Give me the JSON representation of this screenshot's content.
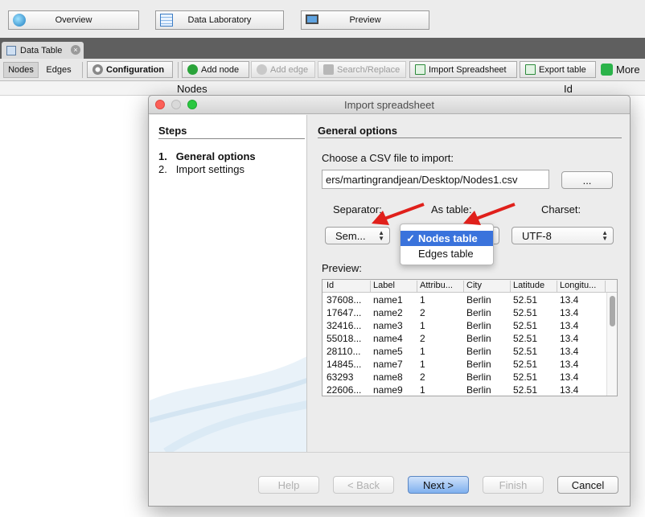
{
  "workspace": {
    "overview": "Overview",
    "data_laboratory": "Data Laboratory",
    "preview": "Preview"
  },
  "tabstrip": {
    "tab_label": "Data Table",
    "close_glyph": "×"
  },
  "toolbar": {
    "nodes_tab": "Nodes",
    "edges_tab": "Edges",
    "configuration": "Configuration",
    "add_node": "Add node",
    "add_edge": "Add edge",
    "search_replace": "Search/Replace",
    "import_spreadsheet": "Import Spreadsheet",
    "export_table": "Export table",
    "more": "More"
  },
  "table": {
    "col_nodes": "Nodes",
    "col_id": "Id"
  },
  "dialog": {
    "title": "Import spreadsheet",
    "steps_title": "Steps",
    "steps": [
      {
        "num": "1.",
        "label": "General options"
      },
      {
        "num": "2.",
        "label": "Import settings"
      }
    ],
    "section_title": "General options",
    "choose_label": "Choose a CSV file to import:",
    "file_path": "ers/martingrandjean/Desktop/Nodes1.csv",
    "browse_label": "...",
    "separator_label": "Separator:",
    "as_table_label": "As table:",
    "charset_label": "Charset:",
    "separator_value": "Sem...",
    "charset_value": "UTF-8",
    "as_table_options": [
      {
        "label": "Nodes table",
        "checkmark": "✓",
        "selected": true
      },
      {
        "label": "Edges table",
        "checkmark": "",
        "selected": false
      }
    ],
    "preview_label": "Preview:",
    "preview": {
      "columns": [
        "Id",
        "Label",
        "Attribu...",
        "City",
        "Latitude",
        "Longitu..."
      ],
      "rows": [
        [
          "37608...",
          "name1",
          "1",
          "Berlin",
          "52.51",
          "13.4"
        ],
        [
          "17647...",
          "name2",
          "2",
          "Berlin",
          "52.51",
          "13.4"
        ],
        [
          "32416...",
          "name3",
          "1",
          "Berlin",
          "52.51",
          "13.4"
        ],
        [
          "55018...",
          "name4",
          "2",
          "Berlin",
          "52.51",
          "13.4"
        ],
        [
          "28110...",
          "name5",
          "1",
          "Berlin",
          "52.51",
          "13.4"
        ],
        [
          "14845...",
          "name7",
          "1",
          "Berlin",
          "52.51",
          "13.4"
        ],
        [
          "63293",
          "name8",
          "2",
          "Berlin",
          "52.51",
          "13.4"
        ],
        [
          "22606...",
          "name9",
          "1",
          "Berlin",
          "52.51",
          "13.4"
        ]
      ]
    },
    "buttons": {
      "help": "Help",
      "back": "< Back",
      "next": "Next >",
      "finish": "Finish",
      "cancel": "Cancel"
    }
  },
  "colors": {
    "annotation_arrow": "#e0201b",
    "selection": "#3a73dc",
    "traffic_close": "#fc5f57",
    "traffic_min": "#d9d9d9",
    "traffic_max": "#2ac840"
  }
}
